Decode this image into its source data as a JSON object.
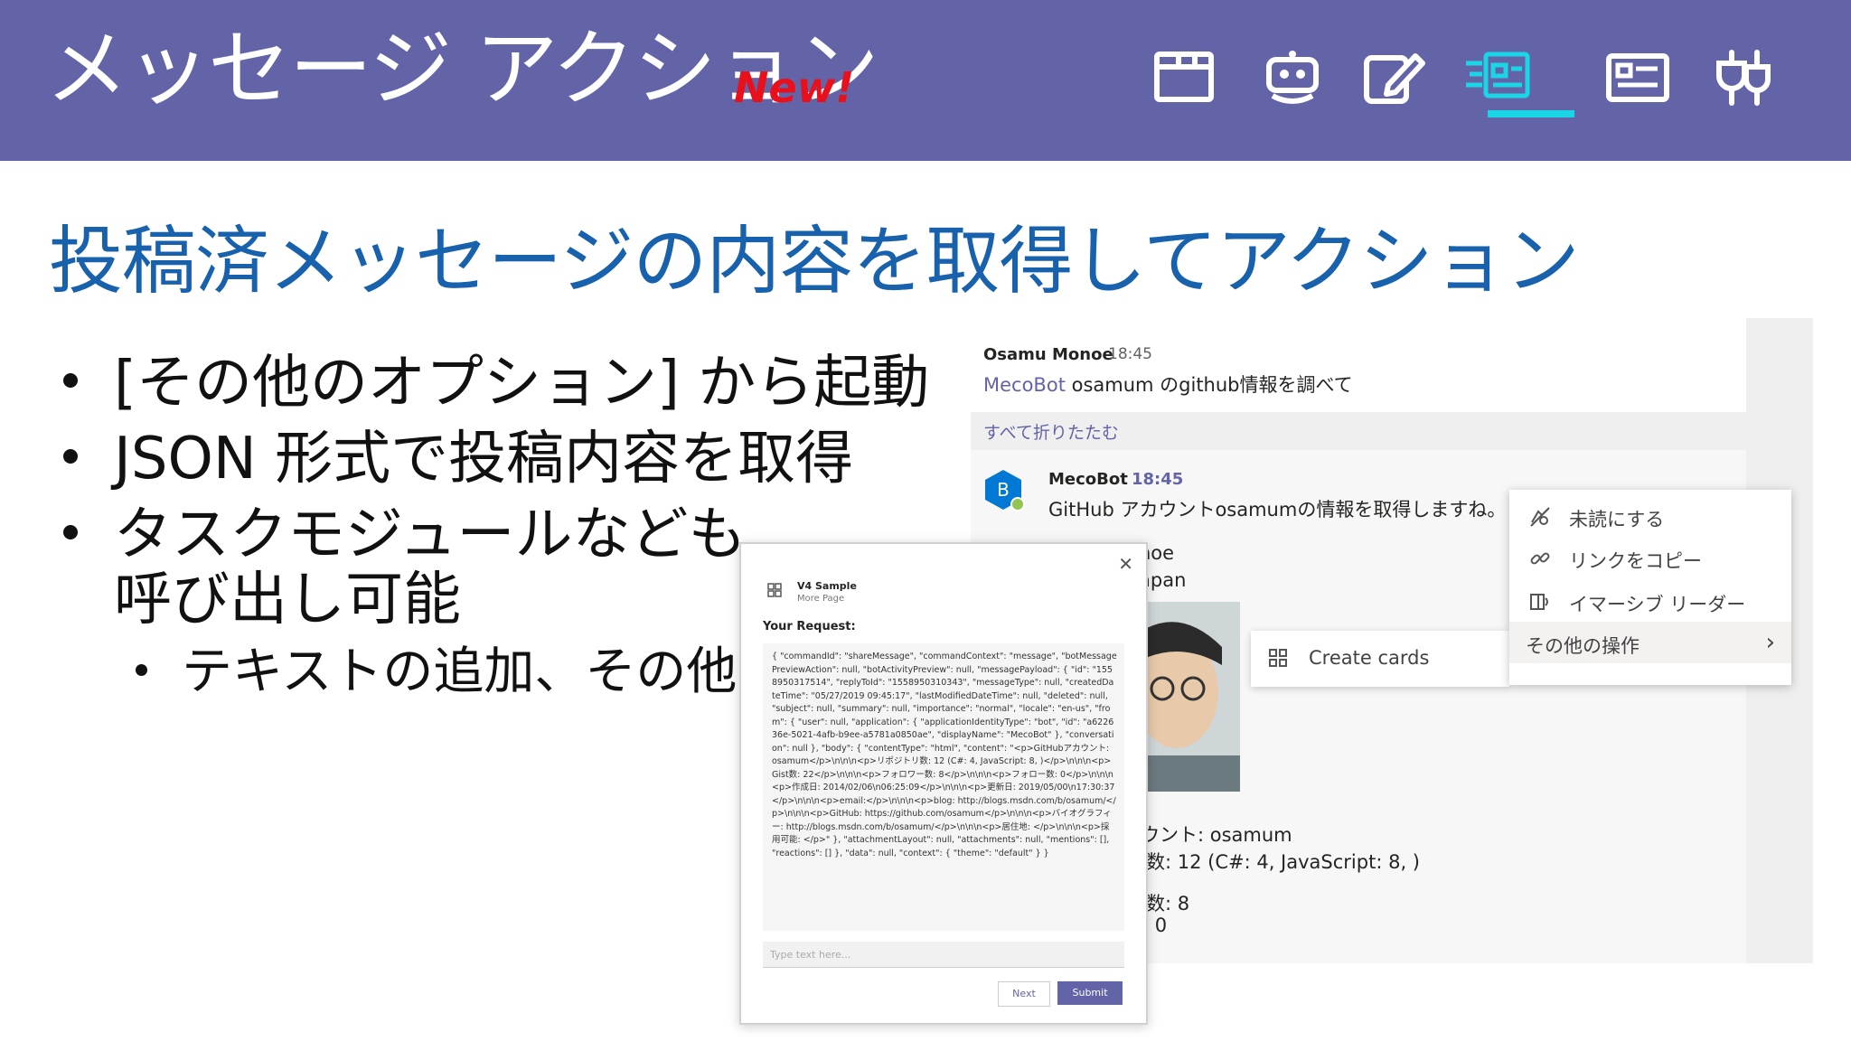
{
  "header": {
    "title": "メッセージ アクション",
    "badge": "New!",
    "nav_icons": [
      "tab-icon",
      "bot-icon",
      "compose-edit-icon",
      "message-action-icon",
      "card-icon",
      "connector-icon"
    ],
    "active_nav_icon": "message-action-icon",
    "colors": {
      "banner": "#6264a7",
      "badge": "#e8101a",
      "active": "#1ad5e6"
    }
  },
  "heading": "投稿済メッセージの内容を取得してアクション",
  "bullets": [
    "[その他のオプション] から起動",
    "JSON 形式で投稿内容を取得",
    "タスクモジュールなども",
    "呼び出し可能"
  ],
  "sub_bullet": "テキストの追加、その他",
  "teams": {
    "message": {
      "author": "Osamu Monoe",
      "time": "18:45",
      "mention": "MecoBot",
      "text": " osamum のgithub情報を調べて"
    },
    "collapse_all": "すべて折りたたむ",
    "reply": {
      "avatar_letter": "B",
      "author": "MecoBot",
      "time": "18:45",
      "text": "GitHub アカウントosamumの情報を取得しますね。",
      "fragments": [
        "noe",
        "apan",
        "ウント: osamum",
        "数: 12 (C#: 4, JavaScript: 8, )",
        "数: 8",
        ": 0"
      ]
    },
    "context_menu": {
      "items": [
        {
          "label": "未読にする",
          "icon": "unread-icon"
        },
        {
          "label": "リンクをコピー",
          "icon": "link-icon"
        },
        {
          "label": "イマーシブ リーダー",
          "icon": "immersive-reader-icon"
        },
        {
          "label": "その他の操作",
          "icon": "chevron-right-icon"
        }
      ]
    },
    "submenu": {
      "label": "Create cards",
      "icon": "app-icon"
    }
  },
  "dialog": {
    "app_name": "V4 Sample",
    "app_sub": "More Page",
    "request_label": "Your Request:",
    "json_text": "{ \"commandId\": \"shareMessage\", \"commandContext\": \"message\", \"botMessagePreviewAction\": null, \"botActivityPreview\": null, \"messagePayload\": { \"id\": \"1558950317514\", \"replyToId\": \"1558950310343\", \"messageType\": null, \"createdDateTime\": \"05/27/2019 09:45:17\", \"lastModifiedDateTime\": null, \"deleted\": null, \"subject\": null, \"summary\": null, \"importance\": \"normal\", \"locale\": \"en-us\", \"from\": { \"user\": null, \"application\": { \"applicationIdentityType\": \"bot\", \"id\": \"a622636e-5021-4afb-b9ee-a5781a0850ae\", \"displayName\": \"MecoBot\" }, \"conversation\": null }, \"body\": { \"contentType\": \"html\", \"content\": \"<p>GitHubアカウント: osamum</p>\\n\\n\\n<p>リポジトリ数: 12 (C#: 4, JavaScript: 8, )</p>\\n\\n\\n<p>Gist数: 22</p>\\n\\n\\n<p>フォロワー数: 8</p>\\n\\n\\n<p>フォロー数: 0</p>\\n\\n\\n<p>作成日: 2014/02/06\\n06:25:09</p>\\n\\n\\n<p>更新日: 2019/05/00\\n17:30:37</p>\\n\\n\\n<p>email:</p>\\n\\n\\n<p>blog: http://blogs.msdn.com/b/osamum/</p>\\n\\n\\n<p>GitHub: https://github.com/osamum</p>\\n\\n\\n<p>バイオグラフィー: http://blogs.msdn.com/b/osamum/</p>\\n\\n\\n<p>居住地: </p>\\n\\n\\n<p>採用可能: </p>\" }, \"attachmentLayout\": null, \"attachments\": null, \"mentions\": [], \"reactions\": [] }, \"data\": null, \"context\": { \"theme\": \"default\" } }",
    "input_placeholder": "Type text here...",
    "next_label": "Next",
    "submit_label": "Submit"
  }
}
